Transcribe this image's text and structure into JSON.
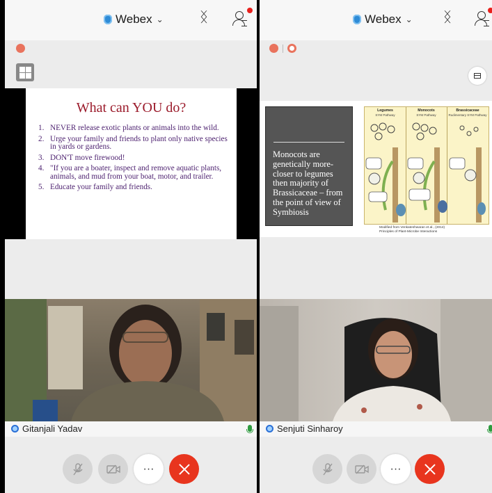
{
  "colors": {
    "accent_red": "#e8351e",
    "webex_blue": "#2e8bd6",
    "slide_title": "#9b1b2b",
    "slide_text": "#4b1f6e",
    "mic_green": "#2e9b3f"
  },
  "left": {
    "app_title": "Webex",
    "slide": {
      "title": "What can YOU do?",
      "items": [
        {
          "n": "1.",
          "text": "NEVER release exotic plants or animals into the wild."
        },
        {
          "n": "2.",
          "text": "Urge your family and friends to plant only native species in yards or gardens."
        },
        {
          "n": "3.",
          "text": "DON'T move firewood!"
        },
        {
          "n": "4.",
          "text": "\"If you are a boater, inspect and remove aquatic plants, animals, and mud from your boat, motor, and trailer."
        },
        {
          "n": "5.",
          "text": "Educate your family and friends."
        }
      ]
    },
    "participant": {
      "name": "Gitanjali Yadav"
    },
    "controls": {
      "more_label": "···"
    }
  },
  "right": {
    "app_title": "Webex",
    "slide": {
      "main_text": "Monocots are genetically more-closer to legumes then majority of Brassicaceae – from the point of view of Symbiosis",
      "comic_columns": [
        {
          "title": "Legumes",
          "sub": "SYM Pathway"
        },
        {
          "title": "Monocots",
          "sub": "SYM Pathway"
        },
        {
          "title": "Brassicaceae",
          "sub": "Rudimentary SYM Pathway"
        }
      ],
      "caption_line1": "Modified from Venkateshwaran et al., (2014)",
      "caption_line2": "Principles of Plant-Microbe Interactions"
    },
    "participant": {
      "name": "Senjuti Sinharoy"
    },
    "controls": {
      "more_label": "···"
    }
  },
  "icons": [
    "shield-icon",
    "chevron-down-icon",
    "bluetooth-icon",
    "participants-icon",
    "notification-dot",
    "grid-view-icon",
    "layout-icon",
    "mute-icon",
    "video-off-icon",
    "more-icon",
    "end-call-icon",
    "mic-icon"
  ]
}
